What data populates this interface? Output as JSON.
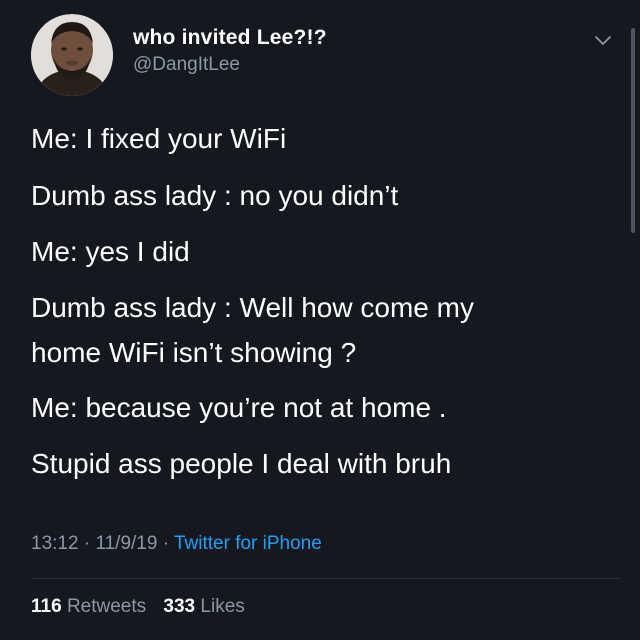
{
  "user": {
    "display_name": "who invited Lee?!?",
    "handle": "@DangItLee"
  },
  "tweet": {
    "lines": [
      "Me: I fixed your WiFi",
      "Dumb ass lady : no you didn’t",
      "Me: yes I did",
      "Dumb ass lady : Well how come my",
      "home WiFi isn’t showing ?",
      "Me: because you’re not at home .",
      "Stupid ass people I deal with bruh"
    ]
  },
  "meta": {
    "time": "13:12",
    "separator": " · ",
    "date": "11/9/19",
    "source": "Twitter for iPhone"
  },
  "stats": {
    "retweets_count": "116",
    "retweets_label": "Retweets",
    "likes_count": "333",
    "likes_label": "Likes"
  },
  "icons": {
    "menu": "chevron-down-icon"
  },
  "colors": {
    "background": "#15181f",
    "text": "#ffffff",
    "secondary": "#8b98a5",
    "link": "#1da1f2"
  }
}
